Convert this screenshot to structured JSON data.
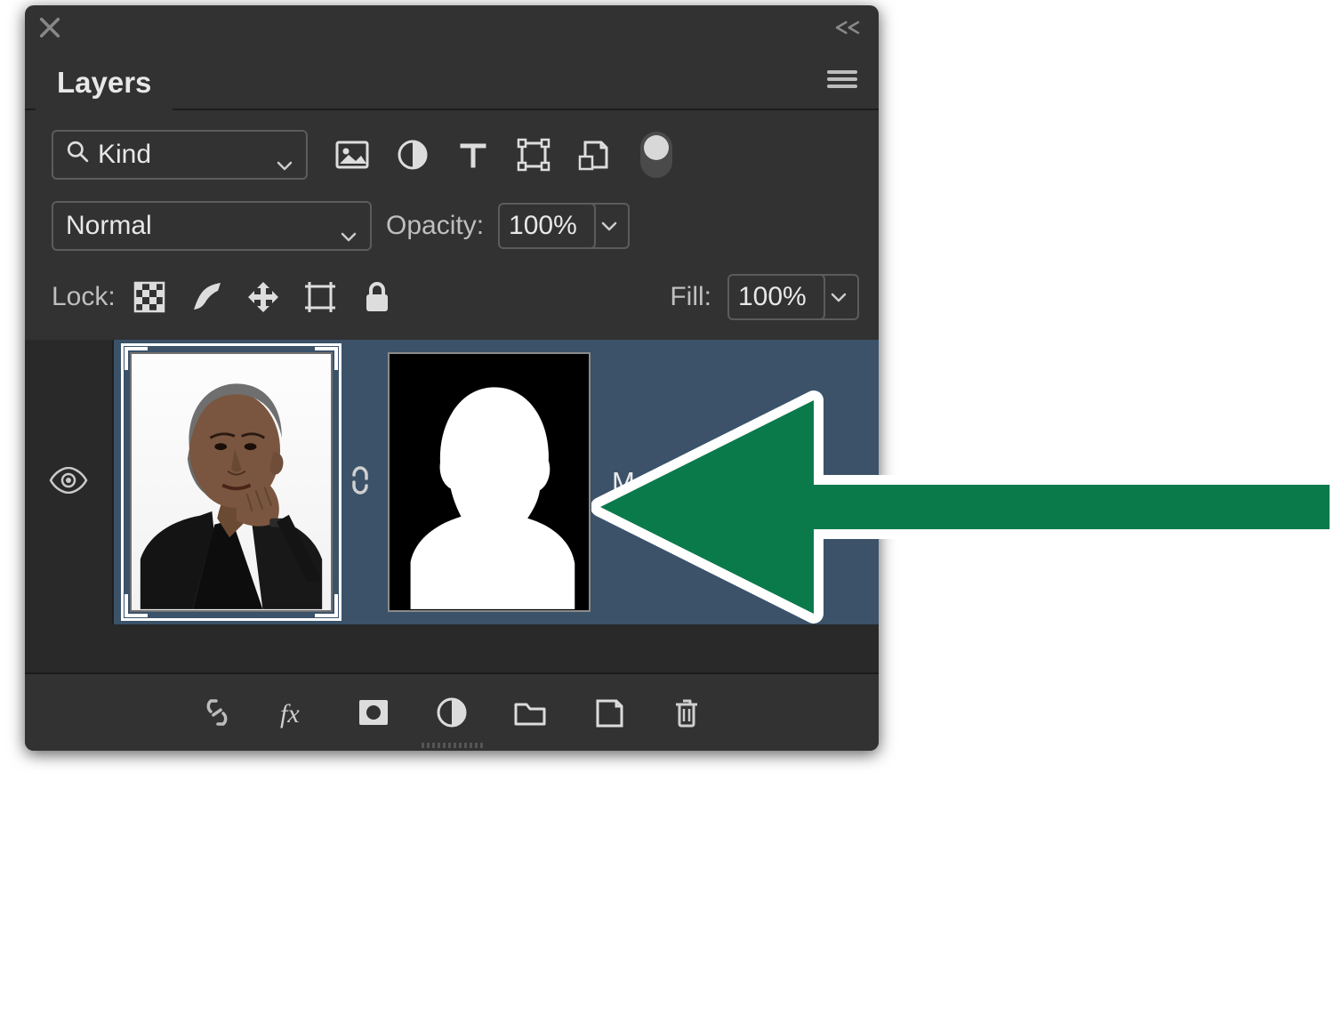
{
  "panel_title": "Layers",
  "filter": {
    "kind_label": "Kind"
  },
  "blend": {
    "mode": "Normal",
    "opacity_label": "Opacity:",
    "opacity_value": "100%"
  },
  "lock": {
    "label": "Lock:",
    "fill_label": "Fill:",
    "fill_value": "100%"
  },
  "layer": {
    "name": "Masked"
  },
  "annotation": {
    "arrow_color": "#0a7a4b"
  }
}
